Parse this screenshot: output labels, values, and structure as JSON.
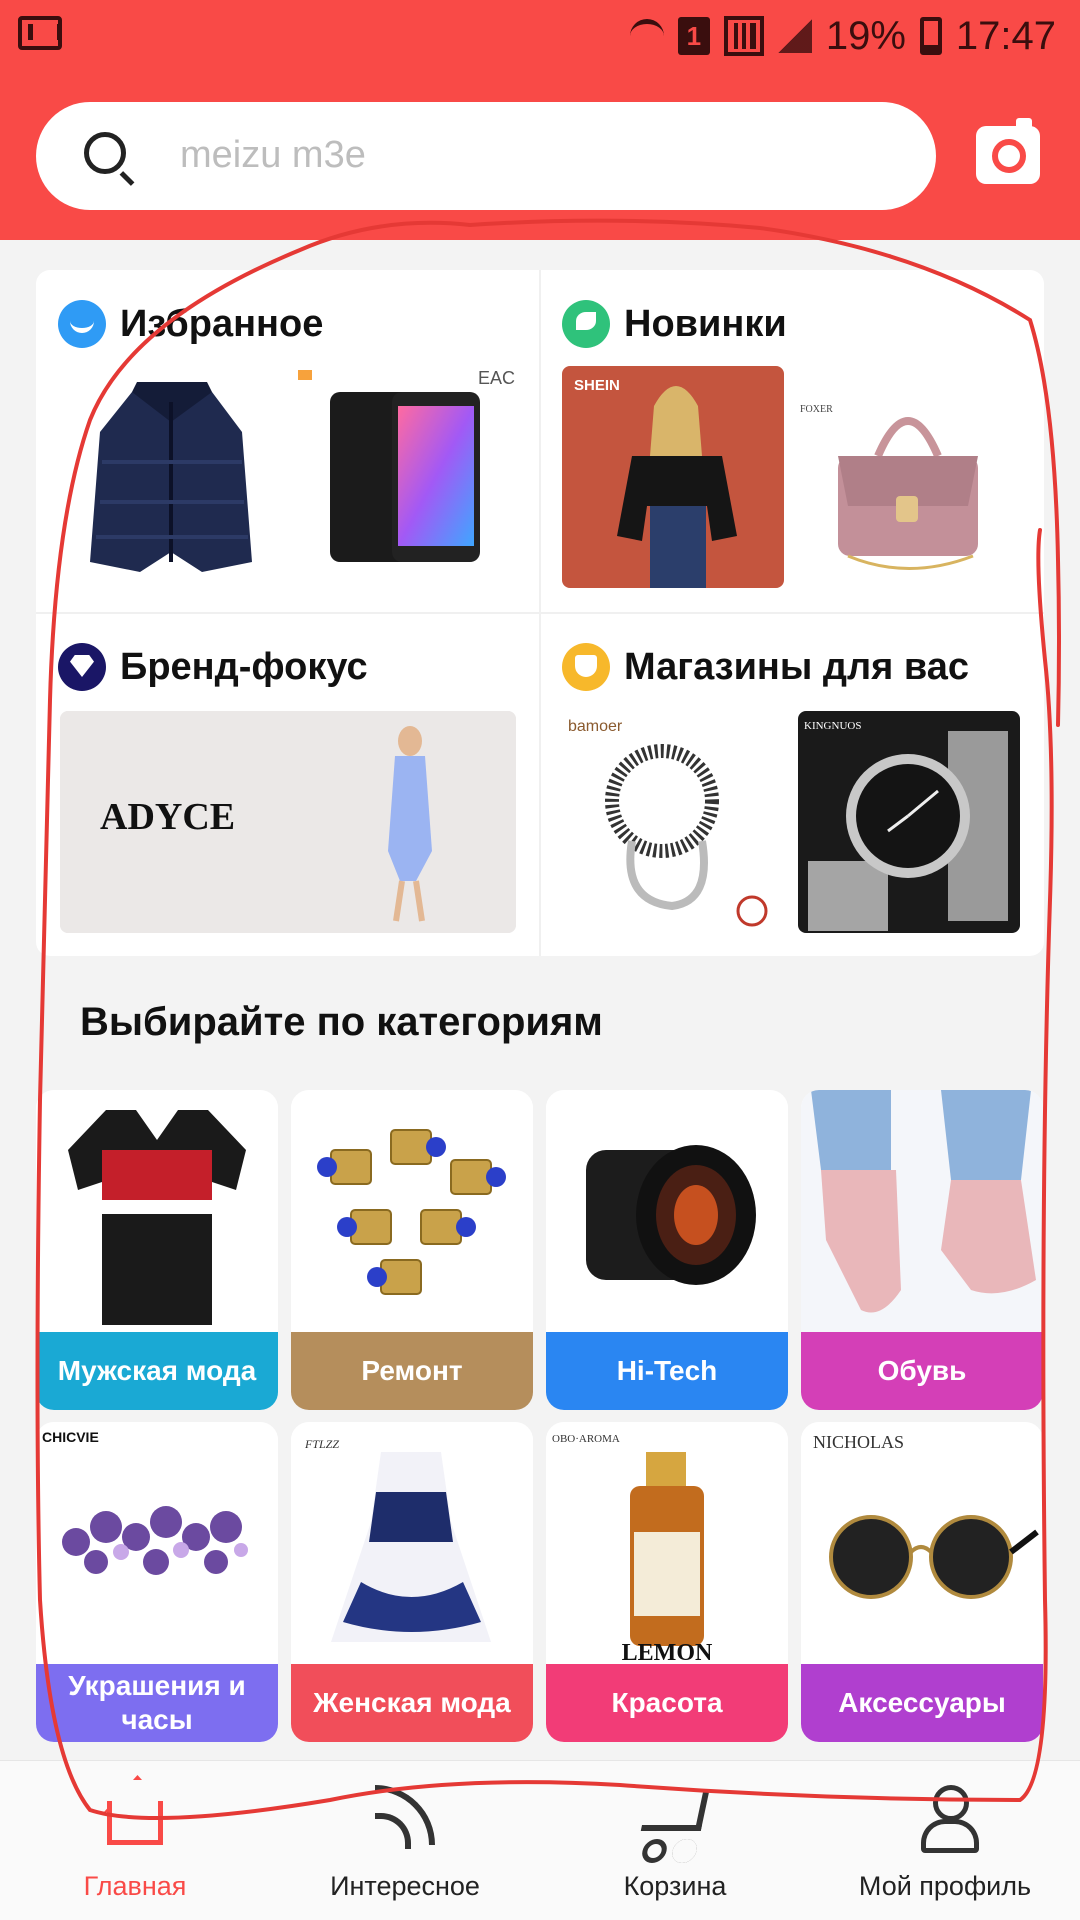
{
  "status_bar": {
    "battery": "19%",
    "time": "17:47",
    "sim": "1"
  },
  "search": {
    "placeholder": "meizu m3e"
  },
  "tiles": [
    {
      "title": "Избранное",
      "icon": "smile-icon"
    },
    {
      "title": "Новинки",
      "icon": "leaf-icon",
      "brand": "SHEIN",
      "brand2": "FOXER"
    },
    {
      "title": "Бренд-фокус",
      "icon": "diamond-icon",
      "brand": "ADYCE"
    },
    {
      "title": "Магазины для вас",
      "icon": "store-icon",
      "brand": "bamoer",
      "brand2": "KINGNUOS"
    }
  ],
  "section_title": "Выбирайте по категориям",
  "categories": [
    {
      "label": "Мужская мода",
      "color": "#1aa9d4"
    },
    {
      "label": "Ремонт",
      "color": "#b58e5c"
    },
    {
      "label": "Hi-Tech",
      "color": "#2a86f2"
    },
    {
      "label": "Обувь",
      "color": "#d43fb7"
    },
    {
      "label": "Украшения и часы",
      "color": "#7d6ef0",
      "brand": "CHICVIE"
    },
    {
      "label": "Женская мода",
      "color": "#f14e5a",
      "brand": "FTLZZ"
    },
    {
      "label": "Красота",
      "color": "#f23c77",
      "brand": "OBO·AROMA",
      "product": "LEMON"
    },
    {
      "label": "Аксессуары",
      "color": "#b03fcf",
      "brand": "NICHOLAS"
    }
  ],
  "nav": [
    {
      "label": "Главная",
      "icon": "home-icon",
      "active": true
    },
    {
      "label": "Интересное",
      "icon": "feed-icon"
    },
    {
      "label": "Корзина",
      "icon": "cart-icon"
    },
    {
      "label": "Мой профиль",
      "icon": "profile-icon"
    }
  ],
  "colors": {
    "header": "#f94a47",
    "accent": "#f94a47",
    "annotation": "#e53935"
  }
}
